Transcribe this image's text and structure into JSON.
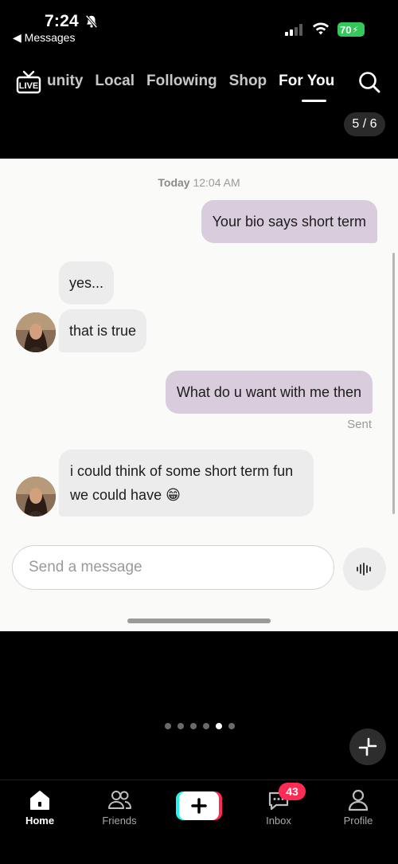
{
  "status_bar": {
    "time": "7:24",
    "back_app": "Messages",
    "battery": "70"
  },
  "top_nav": {
    "tabs": [
      {
        "label": "unity",
        "full_label": "Community"
      },
      {
        "label": "Local"
      },
      {
        "label": "Following"
      },
      {
        "label": "Shop"
      },
      {
        "label": "For You",
        "active": true
      }
    ],
    "live_label": "LIVE",
    "page_counter": "5 / 6"
  },
  "chat": {
    "date_day": "Today",
    "date_time": "12:04 AM",
    "messages": [
      {
        "direction": "out",
        "text": "Your bio says short term"
      },
      {
        "direction": "in",
        "text": "yes..."
      },
      {
        "direction": "in",
        "text": "that is true"
      },
      {
        "direction": "out",
        "text": "What do u want with me then"
      },
      {
        "direction": "in",
        "text": "i could think of some short term fun we could have 😁"
      }
    ],
    "sent_label": "Sent",
    "input_placeholder": "Send a message"
  },
  "carousel": {
    "count": 6,
    "active_index": 4
  },
  "bottom_nav": {
    "home": "Home",
    "friends": "Friends",
    "inbox": "Inbox",
    "inbox_badge": "43",
    "profile": "Profile"
  },
  "colors": {
    "outgoing_bubble": "#d9ccdc",
    "incoming_bubble": "#ececec",
    "badge": "#fe2c55",
    "battery": "#34c759"
  }
}
